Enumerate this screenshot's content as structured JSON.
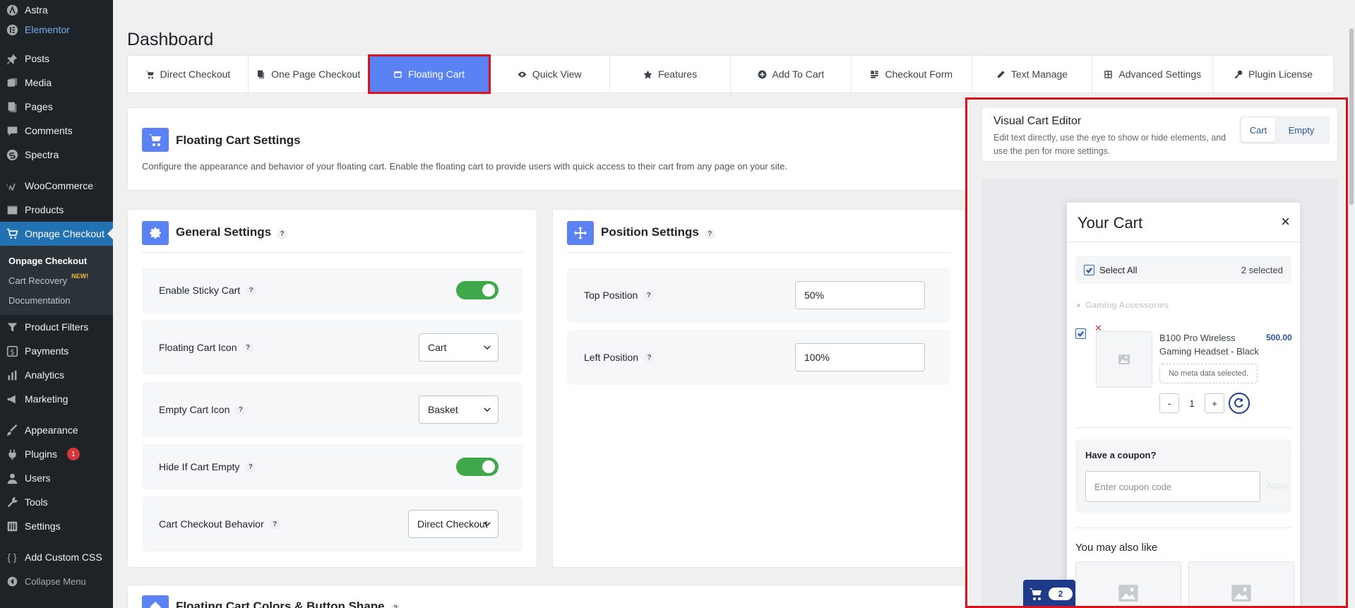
{
  "sidebar": {
    "top_items": [
      {
        "label": "Astra",
        "icon": "astra-icon"
      },
      {
        "label": "Elementor",
        "icon": "elementor-icon"
      }
    ],
    "items": [
      {
        "label": "Posts",
        "icon": "pin-icon"
      },
      {
        "label": "Media",
        "icon": "media-icon"
      },
      {
        "label": "Pages",
        "icon": "pages-icon"
      },
      {
        "label": "Comments",
        "icon": "comment-icon"
      },
      {
        "label": "Spectra",
        "icon": "spectra-icon"
      }
    ],
    "items2": [
      {
        "label": "WooCommerce",
        "icon": "woo-icon"
      },
      {
        "label": "Products",
        "icon": "box-icon"
      },
      {
        "label": "Onpage Checkout",
        "icon": "cart-icon"
      }
    ],
    "submenu": [
      {
        "label": "Onpage Checkout"
      },
      {
        "label": "Cart Recovery",
        "badge": "NEW!"
      },
      {
        "label": "Documentation"
      }
    ],
    "items3": [
      {
        "label": "Product Filters",
        "icon": "filter-icon"
      },
      {
        "label": "Payments",
        "icon": "dollar-icon"
      },
      {
        "label": "Analytics",
        "icon": "chart-icon"
      },
      {
        "label": "Marketing",
        "icon": "megaphone-icon"
      }
    ],
    "items4": [
      {
        "label": "Appearance",
        "icon": "brush-icon"
      },
      {
        "label": "Plugins",
        "icon": "plugin-icon",
        "badge": "1"
      },
      {
        "label": "Users",
        "icon": "user-icon"
      },
      {
        "label": "Tools",
        "icon": "wrench-icon"
      },
      {
        "label": "Settings",
        "icon": "settings-icon"
      }
    ],
    "items5": [
      {
        "label": "Add Custom CSS",
        "icon": "braces-icon"
      },
      {
        "label": "Collapse Menu",
        "icon": "collapse-icon"
      }
    ]
  },
  "page": {
    "title": "Dashboard"
  },
  "tabs": [
    {
      "label": "Direct Checkout"
    },
    {
      "label": "One Page Checkout"
    },
    {
      "label": "Floating Cart"
    },
    {
      "label": "Quick View"
    },
    {
      "label": "Features"
    },
    {
      "label": "Add To Cart"
    },
    {
      "label": "Checkout Form"
    },
    {
      "label": "Text Manage"
    },
    {
      "label": "Advanced Settings"
    },
    {
      "label": "Plugin License"
    }
  ],
  "floating": {
    "title": "Floating Cart Settings",
    "description": "Configure the appearance and behavior of your floating cart. Enable the floating cart to provide users with quick access to their cart from any page on your site."
  },
  "general": {
    "title": "General Settings",
    "help": "?",
    "rows": [
      {
        "label": "Enable Sticky Cart"
      },
      {
        "label": "Floating Cart Icon",
        "value": "Cart"
      },
      {
        "label": "Empty Cart Icon",
        "value": "Basket"
      },
      {
        "label": "Hide If Cart Empty"
      },
      {
        "label": "Cart Checkout Behavior",
        "value": "Direct Checkout"
      }
    ]
  },
  "position": {
    "title": "Position Settings",
    "rows": [
      {
        "label": "Top Position",
        "value": "50%"
      },
      {
        "label": "Left Position",
        "value": "100%"
      }
    ]
  },
  "colors": {
    "title": "Floating Cart Colors & Button Shape"
  },
  "editor": {
    "title": "Visual Cart Editor",
    "description": "Edit text directly, use the eye to show or hide elements, and use the pen for more settings.",
    "btn_cart": "Cart",
    "btn_empty": "Empty"
  },
  "cart": {
    "title": "Your Cart",
    "close": "×",
    "select_all": "Select All",
    "selected": "2 selected",
    "category": "Gaming Accessories",
    "item_name": "B100 Pro Wireless Gaming Headset - Black",
    "item_price": "500.00",
    "meta": "No meta data selected.",
    "qty": "1",
    "minus": "-",
    "plus": "+",
    "coupon_title": "Have a coupon?",
    "coupon_placeholder": "Enter coupon code",
    "apply": "Apply",
    "also_like": "You may also like",
    "float_count": "2"
  }
}
